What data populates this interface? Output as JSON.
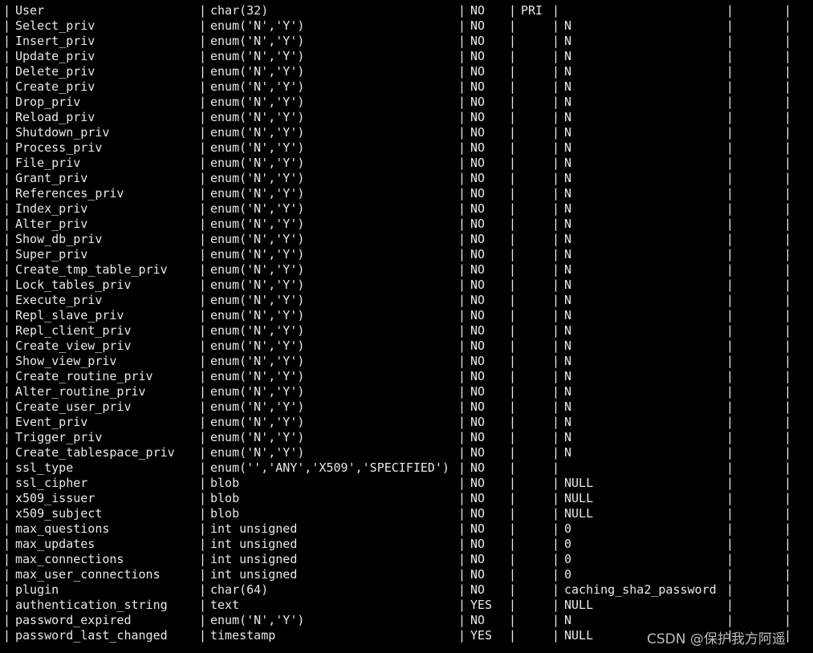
{
  "terminal": {
    "rows": [
      {
        "field": "User",
        "type": "char(32)",
        "null": "NO",
        "key": "PRI",
        "default": ""
      },
      {
        "field": "Select_priv",
        "type": "enum('N','Y')",
        "null": "NO",
        "key": "",
        "default": "N"
      },
      {
        "field": "Insert_priv",
        "type": "enum('N','Y')",
        "null": "NO",
        "key": "",
        "default": "N"
      },
      {
        "field": "Update_priv",
        "type": "enum('N','Y')",
        "null": "NO",
        "key": "",
        "default": "N"
      },
      {
        "field": "Delete_priv",
        "type": "enum('N','Y')",
        "null": "NO",
        "key": "",
        "default": "N"
      },
      {
        "field": "Create_priv",
        "type": "enum('N','Y')",
        "null": "NO",
        "key": "",
        "default": "N"
      },
      {
        "field": "Drop_priv",
        "type": "enum('N','Y')",
        "null": "NO",
        "key": "",
        "default": "N"
      },
      {
        "field": "Reload_priv",
        "type": "enum('N','Y')",
        "null": "NO",
        "key": "",
        "default": "N"
      },
      {
        "field": "Shutdown_priv",
        "type": "enum('N','Y')",
        "null": "NO",
        "key": "",
        "default": "N"
      },
      {
        "field": "Process_priv",
        "type": "enum('N','Y')",
        "null": "NO",
        "key": "",
        "default": "N"
      },
      {
        "field": "File_priv",
        "type": "enum('N','Y')",
        "null": "NO",
        "key": "",
        "default": "N"
      },
      {
        "field": "Grant_priv",
        "type": "enum('N','Y')",
        "null": "NO",
        "key": "",
        "default": "N"
      },
      {
        "field": "References_priv",
        "type": "enum('N','Y')",
        "null": "NO",
        "key": "",
        "default": "N"
      },
      {
        "field": "Index_priv",
        "type": "enum('N','Y')",
        "null": "NO",
        "key": "",
        "default": "N"
      },
      {
        "field": "Alter_priv",
        "type": "enum('N','Y')",
        "null": "NO",
        "key": "",
        "default": "N"
      },
      {
        "field": "Show_db_priv",
        "type": "enum('N','Y')",
        "null": "NO",
        "key": "",
        "default": "N"
      },
      {
        "field": "Super_priv",
        "type": "enum('N','Y')",
        "null": "NO",
        "key": "",
        "default": "N"
      },
      {
        "field": "Create_tmp_table_priv",
        "type": "enum('N','Y')",
        "null": "NO",
        "key": "",
        "default": "N"
      },
      {
        "field": "Lock_tables_priv",
        "type": "enum('N','Y')",
        "null": "NO",
        "key": "",
        "default": "N"
      },
      {
        "field": "Execute_priv",
        "type": "enum('N','Y')",
        "null": "NO",
        "key": "",
        "default": "N"
      },
      {
        "field": "Repl_slave_priv",
        "type": "enum('N','Y')",
        "null": "NO",
        "key": "",
        "default": "N"
      },
      {
        "field": "Repl_client_priv",
        "type": "enum('N','Y')",
        "null": "NO",
        "key": "",
        "default": "N"
      },
      {
        "field": "Create_view_priv",
        "type": "enum('N','Y')",
        "null": "NO",
        "key": "",
        "default": "N"
      },
      {
        "field": "Show_view_priv",
        "type": "enum('N','Y')",
        "null": "NO",
        "key": "",
        "default": "N"
      },
      {
        "field": "Create_routine_priv",
        "type": "enum('N','Y')",
        "null": "NO",
        "key": "",
        "default": "N"
      },
      {
        "field": "Alter_routine_priv",
        "type": "enum('N','Y')",
        "null": "NO",
        "key": "",
        "default": "N"
      },
      {
        "field": "Create_user_priv",
        "type": "enum('N','Y')",
        "null": "NO",
        "key": "",
        "default": "N"
      },
      {
        "field": "Event_priv",
        "type": "enum('N','Y')",
        "null": "NO",
        "key": "",
        "default": "N"
      },
      {
        "field": "Trigger_priv",
        "type": "enum('N','Y')",
        "null": "NO",
        "key": "",
        "default": "N"
      },
      {
        "field": "Create_tablespace_priv",
        "type": "enum('N','Y')",
        "null": "NO",
        "key": "",
        "default": "N"
      },
      {
        "field": "ssl_type",
        "type": "enum('','ANY','X509','SPECIFIED')",
        "null": "NO",
        "key": "",
        "default": ""
      },
      {
        "field": "ssl_cipher",
        "type": "blob",
        "null": "NO",
        "key": "",
        "default": "NULL"
      },
      {
        "field": "x509_issuer",
        "type": "blob",
        "null": "NO",
        "key": "",
        "default": "NULL"
      },
      {
        "field": "x509_subject",
        "type": "blob",
        "null": "NO",
        "key": "",
        "default": "NULL"
      },
      {
        "field": "max_questions",
        "type": "int unsigned",
        "null": "NO",
        "key": "",
        "default": "0"
      },
      {
        "field": "max_updates",
        "type": "int unsigned",
        "null": "NO",
        "key": "",
        "default": "0"
      },
      {
        "field": "max_connections",
        "type": "int unsigned",
        "null": "NO",
        "key": "",
        "default": "0"
      },
      {
        "field": "max_user_connections",
        "type": "int unsigned",
        "null": "NO",
        "key": "",
        "default": "0"
      },
      {
        "field": "plugin",
        "type": "char(64)",
        "null": "NO",
        "key": "",
        "default": "caching_sha2_password"
      },
      {
        "field": "authentication_string",
        "type": "text",
        "null": "YES",
        "key": "",
        "default": "NULL"
      },
      {
        "field": "password_expired",
        "type": "enum('N','Y')",
        "null": "NO",
        "key": "",
        "default": "N"
      },
      {
        "field": "password_last_changed",
        "type": "timestamp",
        "null": "YES",
        "key": "",
        "default": "NULL"
      }
    ]
  },
  "watermark": "CSDN @保护我方阿遥"
}
